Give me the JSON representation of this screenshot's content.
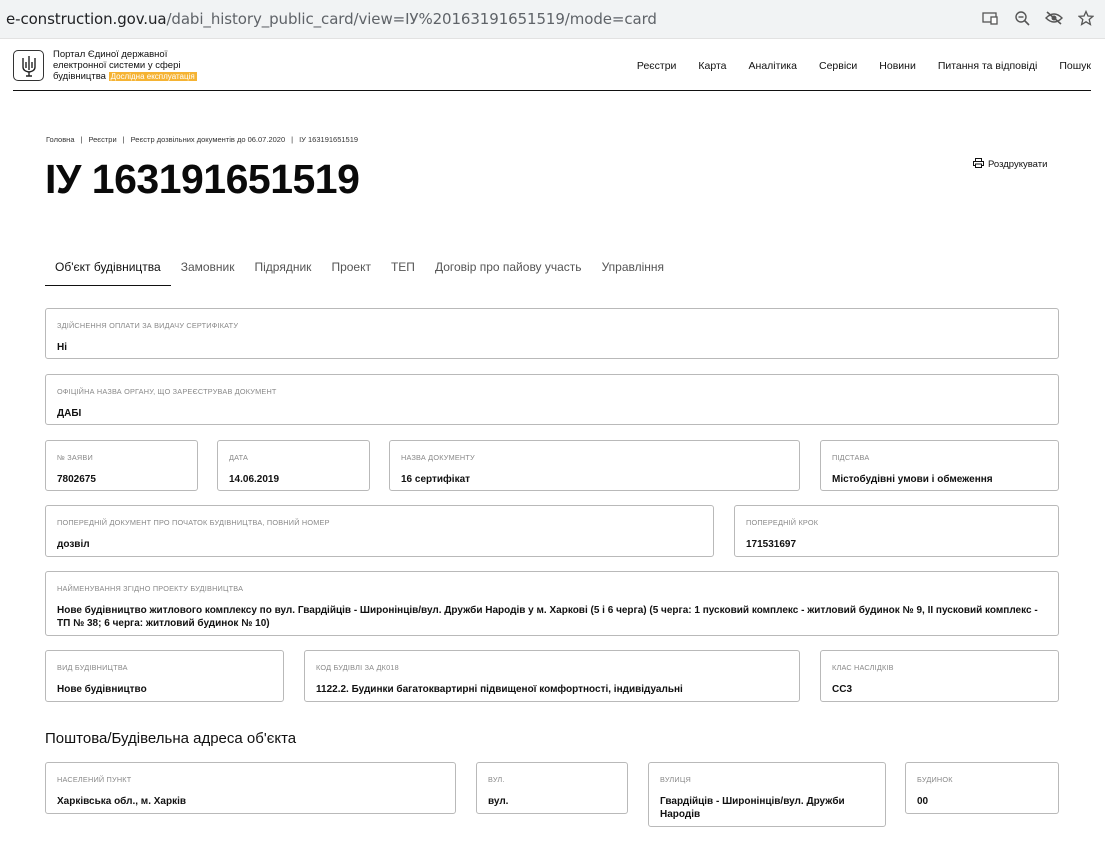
{
  "browser": {
    "url_host": "e-construction.gov.ua",
    "url_path": "/dabi_history_public_card/view=ІУ%20163191651519/mode=card",
    "icons": [
      "cast-icon",
      "zoom-icon",
      "eye-off-icon",
      "star-icon"
    ]
  },
  "header": {
    "portal_line1": "Портал Єдиної державної",
    "portal_line2": "електронної системи у сфері",
    "portal_line3": "будівництва",
    "beta_badge": "Дослідна експлуатація",
    "nav": [
      "Реєстри",
      "Карта",
      "Аналітика",
      "Сервіси",
      "Новини",
      "Питання та відповіді",
      "Пошук"
    ]
  },
  "breadcrumb": [
    "Головна",
    "Реєстри",
    "Реєстр дозвільних документів до 06.07.2020",
    "ІУ 163191651519"
  ],
  "title": "ІУ 163191651519",
  "print_label": "Роздрукувати",
  "tabs": [
    "Об'єкт будівництва",
    "Замовник",
    "Підрядник",
    "Проект",
    "ТЕП",
    "Договір про пайову участь",
    "Управління"
  ],
  "fields": {
    "payment": {
      "label": "Здійснення оплати за видачу сертифікату",
      "value": "Ні"
    },
    "authority": {
      "label": "Офіційна назва органу, що зареєстрував документ",
      "value": "ДАБІ"
    },
    "app_no": {
      "label": "№ заяви",
      "value": "7802675"
    },
    "date": {
      "label": "Дата",
      "value": "14.06.2019"
    },
    "doc_name": {
      "label": "Назва документу",
      "value": "16 сертифікат"
    },
    "basis": {
      "label": "Підстава",
      "value": "Містобудівні умови і обмеження"
    },
    "prev_doc": {
      "label": "Попередній документ про початок будівництва, повний номер",
      "value": "дозвіл"
    },
    "prev_step": {
      "label": "Попередній крок",
      "value": "171531697"
    },
    "project_name": {
      "label": "Найменування згідно проекту будівництва",
      "value": "Нове будівництво житлового комплексу по вул. Гвардійців - Широнінців/вул. Дружби Народів у м. Харкові (5 і 6 черга) (5 черга: 1 пусковий комплекс - житловий будинок № 9, II пусковий комплекс - ТП № 38; 6 черга: житловий будинок № 10)"
    },
    "build_type": {
      "label": "Вид будівництва",
      "value": "Нове будівництво"
    },
    "building_code": {
      "label": "Код будівлі за ДК018",
      "value": "1122.2. Будинки багатоквартирні підвищеної комфортності, індивідуальні"
    },
    "consequence_class": {
      "label": "Клас наслідків",
      "value": "СС3"
    }
  },
  "address_section_title": "Поштова/Будівельна адреса об'єкта",
  "address": {
    "settlement": {
      "label": "Населений пункт",
      "value": "Харківська обл., м. Харків"
    },
    "street_type": {
      "label": "вул.",
      "value": "вул."
    },
    "street": {
      "label": "Вулиця",
      "value": "Гвардійців - Широнінців/вул. Дружби Народів"
    },
    "building": {
      "label": "Будинок",
      "value": "00"
    }
  }
}
